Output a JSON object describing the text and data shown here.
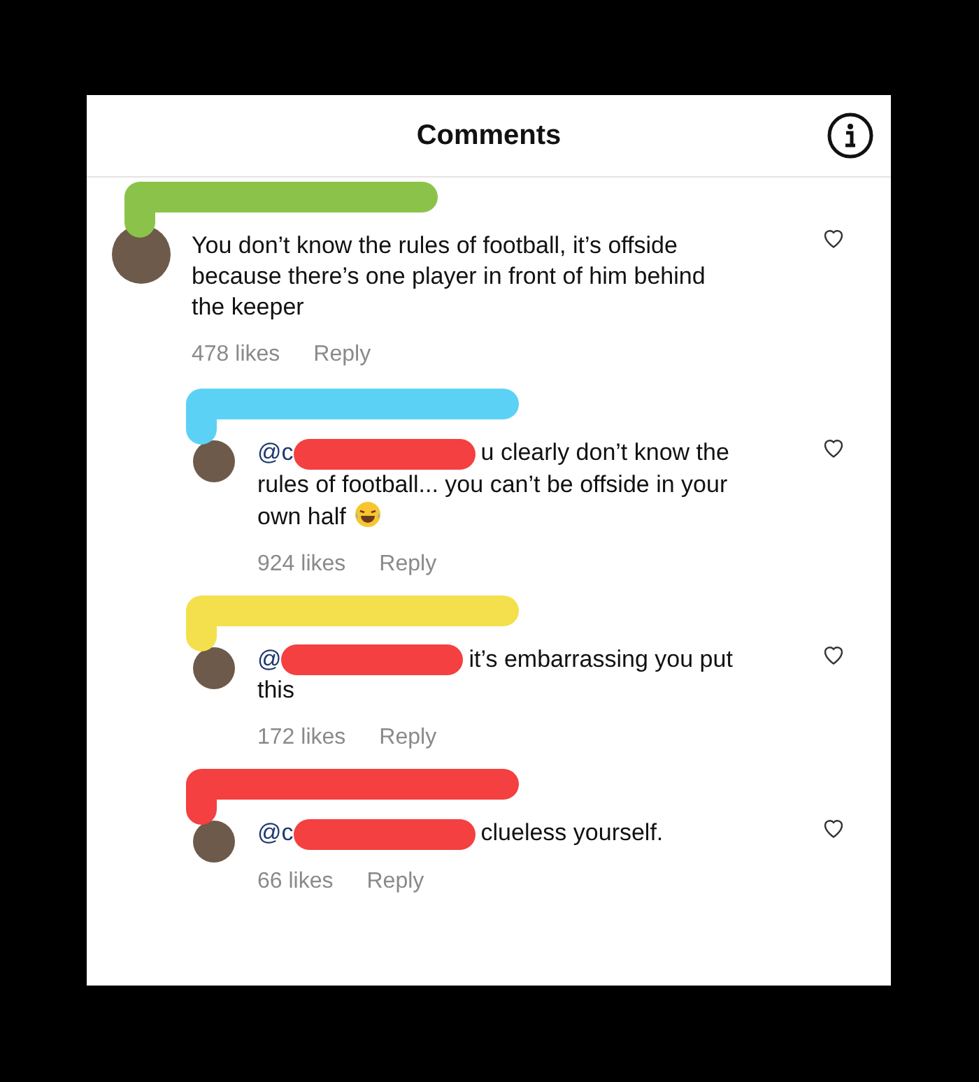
{
  "header": {
    "title": "Comments"
  },
  "comments": [
    {
      "kind": "comment",
      "redacted": false,
      "lines": [
        "You don’t know the rules of football, it’s offside because there’s one player in front of him behind the keeper"
      ],
      "emoji": false,
      "likes": "478 likes",
      "reply": "Reply",
      "liked": false,
      "color": "#8bc34a"
    },
    {
      "kind": "reply",
      "mention": "@c",
      "redacted": true,
      "lines": [
        "u clearly don’t know the",
        "rules of football... you can’t be offside in your own half"
      ],
      "emoji": true,
      "likes": "924 likes",
      "reply": "Reply",
      "liked": false,
      "color": "#5bd2f5"
    },
    {
      "kind": "reply",
      "mention": "@",
      "redacted": true,
      "lines": [
        "it’s embarrassing you put",
        "this"
      ],
      "emoji": false,
      "likes": "172 likes",
      "reply": "Reply",
      "liked": false,
      "color": "#f4e04d"
    },
    {
      "kind": "reply",
      "mention": "@c",
      "redacted": true,
      "lines": [
        "clueless yourself."
      ],
      "emoji": false,
      "likes": "66 likes",
      "reply": "Reply",
      "liked": false,
      "color": "#f44040"
    }
  ]
}
